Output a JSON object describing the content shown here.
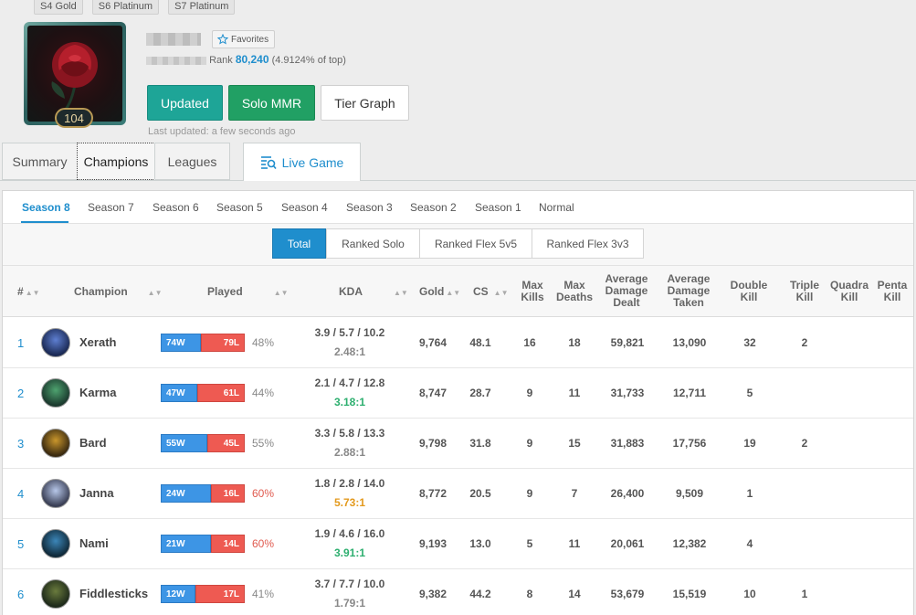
{
  "tiers": [
    "S4 Gold",
    "S6 Platinum",
    "S7 Platinum"
  ],
  "profile": {
    "level": "104",
    "favorites_label": "Favorites",
    "rank_label": "Rank",
    "rank_value": "80,240",
    "rank_pct": "(4.9124% of top)",
    "last_updated": "Last updated: a few seconds ago"
  },
  "buttons": {
    "updated": "Updated",
    "solo_mmr": "Solo MMR",
    "tier_graph": "Tier Graph"
  },
  "tabs": [
    "Summary",
    "Champions",
    "Leagues",
    "Live Game"
  ],
  "seasons": [
    "Season 8",
    "Season 7",
    "Season 6",
    "Season 5",
    "Season 4",
    "Season 3",
    "Season 2",
    "Season 1",
    "Normal"
  ],
  "queues": [
    "Total",
    "Ranked Solo",
    "Ranked Flex 5v5",
    "Ranked Flex 3v3"
  ],
  "headers": {
    "idx": "#",
    "champion": "Champion",
    "played": "Played",
    "kda": "KDA",
    "gold": "Gold",
    "cs": "CS",
    "max_kills": "Max Kills",
    "max_deaths": "Max Deaths",
    "avg_dmg_dealt": "Average Damage Dealt",
    "avg_dmg_taken": "Average Damage Taken",
    "double_kill": "Double Kill",
    "triple_kill": "Triple Kill",
    "quadra_kill": "Quadra Kill",
    "penta_kill": "Penta Kill"
  },
  "rows": [
    {
      "idx": "1",
      "name": "Xerath",
      "wins": "74W",
      "losses": "79L",
      "win_frac": 0.48,
      "pct": "48%",
      "kda": "3.9 / 5.7 / 10.2",
      "ratio": "2.48:1",
      "ratio_color": "#888888",
      "gold": "9,764",
      "cs": "48.1",
      "max_kills": "16",
      "max_deaths": "18",
      "dmg_dealt": "59,821",
      "dmg_taken": "13,090",
      "double": "32",
      "triple": "2",
      "quadra": "",
      "penta": ""
    },
    {
      "idx": "2",
      "name": "Karma",
      "wins": "47W",
      "losses": "61L",
      "win_frac": 0.44,
      "pct": "44%",
      "kda": "2.1 / 4.7 / 12.8",
      "ratio": "3.18:1",
      "ratio_color": "#2daf6f",
      "gold": "8,747",
      "cs": "28.7",
      "max_kills": "9",
      "max_deaths": "11",
      "dmg_dealt": "31,733",
      "dmg_taken": "12,711",
      "double": "5",
      "triple": "",
      "quadra": "",
      "penta": ""
    },
    {
      "idx": "3",
      "name": "Bard",
      "wins": "55W",
      "losses": "45L",
      "win_frac": 0.55,
      "pct": "55%",
      "kda": "3.3 / 5.8 / 13.3",
      "ratio": "2.88:1",
      "ratio_color": "#888888",
      "gold": "9,798",
      "cs": "31.8",
      "max_kills": "9",
      "max_deaths": "15",
      "dmg_dealt": "31,883",
      "dmg_taken": "17,756",
      "double": "19",
      "triple": "2",
      "quadra": "",
      "penta": ""
    },
    {
      "idx": "4",
      "name": "Janna",
      "wins": "24W",
      "losses": "16L",
      "win_frac": 0.6,
      "pct": "60%",
      "kda": "1.8 / 2.8 / 14.0",
      "ratio": "5.73:1",
      "ratio_color": "#e39a1e",
      "gold": "8,772",
      "cs": "20.5",
      "max_kills": "9",
      "max_deaths": "7",
      "dmg_dealt": "26,400",
      "dmg_taken": "9,509",
      "double": "1",
      "triple": "",
      "quadra": "",
      "penta": ""
    },
    {
      "idx": "5",
      "name": "Nami",
      "wins": "21W",
      "losses": "14L",
      "win_frac": 0.6,
      "pct": "60%",
      "kda": "1.9 / 4.6 / 16.0",
      "ratio": "3.91:1",
      "ratio_color": "#2daf6f",
      "gold": "9,193",
      "cs": "13.0",
      "max_kills": "5",
      "max_deaths": "11",
      "dmg_dealt": "20,061",
      "dmg_taken": "12,382",
      "double": "4",
      "triple": "",
      "quadra": "",
      "penta": ""
    },
    {
      "idx": "6",
      "name": "Fiddlesticks",
      "wins": "12W",
      "losses": "17L",
      "win_frac": 0.41,
      "pct": "41%",
      "kda": "3.7 / 7.7 / 10.0",
      "ratio": "1.79:1",
      "ratio_color": "#888888",
      "gold": "9,382",
      "cs": "44.2",
      "max_kills": "8",
      "max_deaths": "14",
      "dmg_dealt": "53,679",
      "dmg_taken": "15,519",
      "double": "10",
      "triple": "1",
      "quadra": "",
      "penta": ""
    }
  ],
  "colors": {
    "accent": "#1f8ecd",
    "win": "#3d95e5",
    "loss": "#ee5a52",
    "updated": "#1ea597",
    "mmr": "#21a064"
  }
}
